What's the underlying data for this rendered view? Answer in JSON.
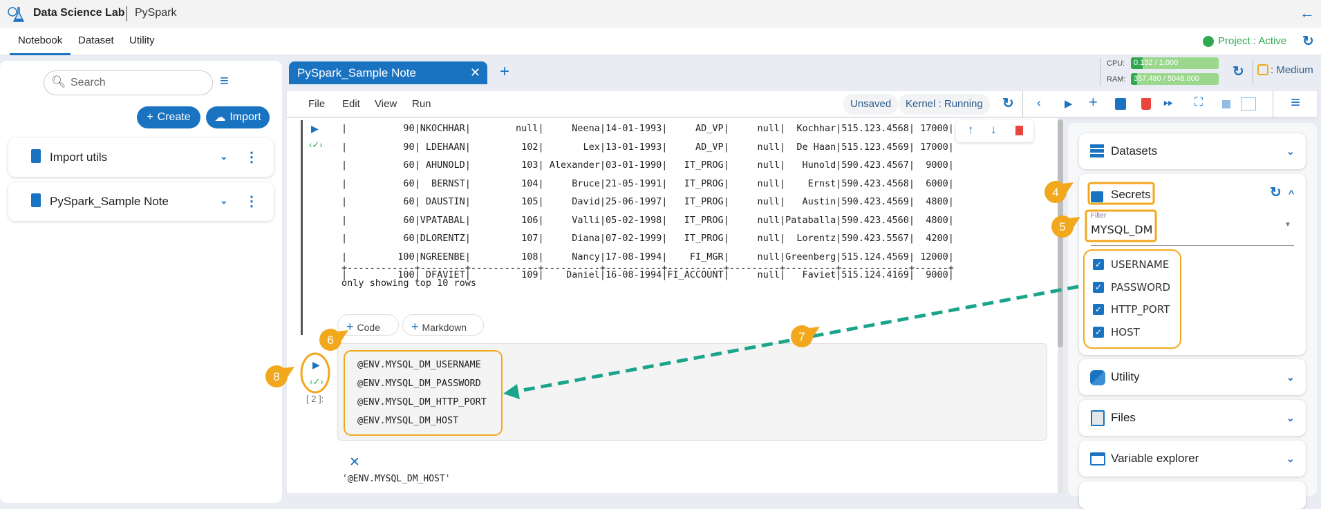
{
  "header": {
    "app_title": "Data Science Lab",
    "project": "PySpark"
  },
  "nav": {
    "tabs": [
      "Notebook",
      "Dataset",
      "Utility"
    ],
    "active": "Notebook",
    "project_status": "Project : Active",
    "status_color": "#2fa84f"
  },
  "left": {
    "search_placeholder": "Search",
    "create_label": "Create",
    "import_label": "Import",
    "notebooks": [
      {
        "name": "Import utils"
      },
      {
        "name": "PySpark_Sample Note"
      }
    ]
  },
  "notebook_tab": {
    "title": "PySpark_Sample Note"
  },
  "resources": {
    "cpu_label": "CPU:",
    "cpu_value": "0.132 / 1.000",
    "cpu_fraction": 0.132,
    "ram_label": "RAM:",
    "ram_value": "357.480 / 5048.000",
    "ram_fraction": 0.0708,
    "instance": ": Medium"
  },
  "menu": {
    "items": [
      "File",
      "Edit",
      "View",
      "Run"
    ],
    "save_status": "Unsaved",
    "kernel_status": "Kernel : Running"
  },
  "output": {
    "rows": [
      "|          90|NKOCHHAR|        null|     Neena|14-01-1993|     AD_VP|     null|  Kochhar|515.123.4568| 17000|",
      "|          90| LDEHAAN|         102|       Lex|13-01-1993|     AD_VP|     null|  De Haan|515.123.4569| 17000|",
      "|          60| AHUNOLD|         103| Alexander|03-01-1990|   IT_PROG|     null|   Hunold|590.423.4567|  9000|",
      "|          60|  BERNST|         104|     Bruce|21-05-1991|   IT_PROG|     null|    Ernst|590.423.4568|  6000|",
      "|          60| DAUSTIN|         105|     David|25-06-1997|   IT_PROG|     null|   Austin|590.423.4569|  4800|",
      "|          60|VPATABAL|         106|     Valli|05-02-1998|   IT_PROG|     null|Pataballa|590.423.4560|  4800|",
      "|          60|DLORENTZ|         107|     Diana|07-02-1999|   IT_PROG|     null|  Lorentz|590.423.5567|  4200|",
      "|         100|NGREENBE|         108|     Nancy|17-08-1994|    FI_MGR|     null|Greenberg|515.124.4569| 12000|",
      "|         100| DFAVIET|         109|    Daniel|16-08-1994|FI_ACCOUNT|     null|   Faviet|515.124.4169|  9000|"
    ],
    "separator": "+------------+--------+------------+----------+----------+----------+---------+---------+------------+------+",
    "footer": "only showing top 10 rows"
  },
  "add_cell": {
    "code": "Code",
    "markdown": "Markdown"
  },
  "cell": {
    "exec_count": "[ 2 ]:",
    "lines": [
      "@ENV.MYSQL_DM_USERNAME",
      "@ENV.MYSQL_DM_PASSWORD",
      "@ENV.MYSQL_DM_HTTP_PORT",
      "@ENV.MYSQL_DM_HOST"
    ],
    "result": "'@ENV.MYSQL_DM_HOST'"
  },
  "right": {
    "datasets": "Datasets",
    "secrets": "Secrets",
    "filter_label": "Filter",
    "filter_value": "MYSQL_DM",
    "secret_items": [
      "USERNAME",
      "PASSWORD",
      "HTTP_PORT",
      "HOST"
    ],
    "utility": "Utility",
    "files": "Files",
    "variable_explorer": "Variable explorer"
  },
  "annotations": {
    "markers": [
      "4",
      "5",
      "6",
      "7",
      "8"
    ],
    "color": "#f2a81d",
    "arrow_color": "#1aa58a"
  }
}
